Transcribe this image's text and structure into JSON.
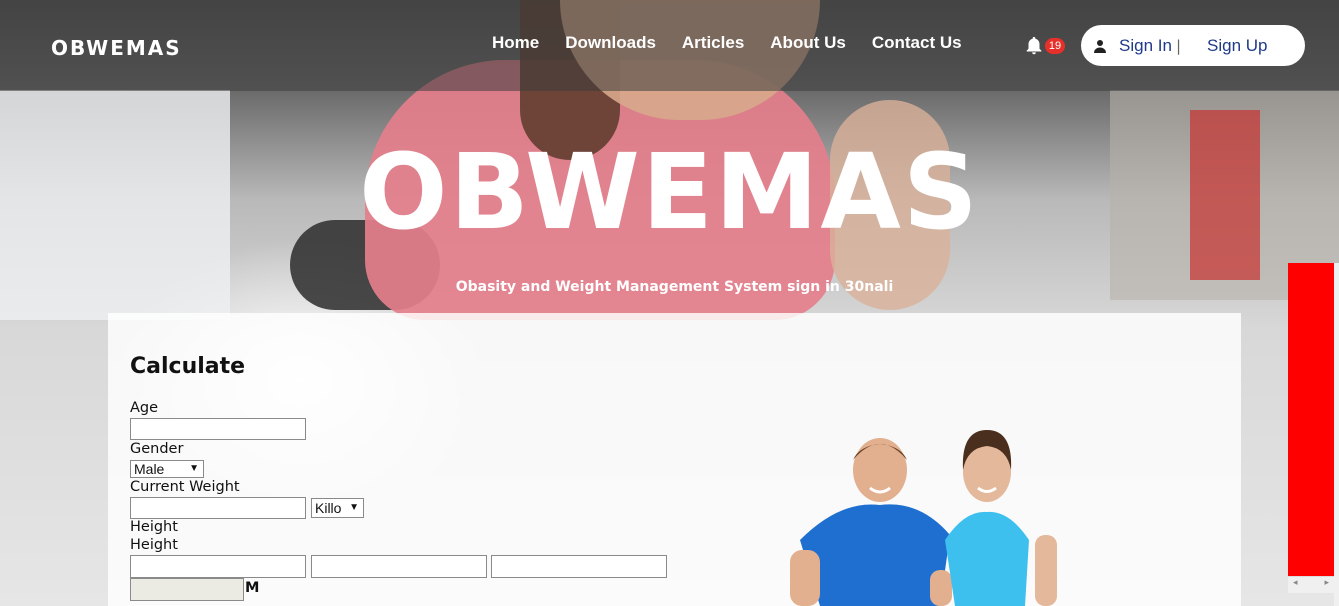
{
  "brand": "OBWEMAS",
  "nav": {
    "items": [
      "Home",
      "Downloads",
      "Articles",
      "About Us",
      "Contact Us"
    ],
    "notification_count": "19",
    "sign_in": "Sign In",
    "separator": "|",
    "sign_up": "Sign Up"
  },
  "hero": {
    "title": "OBWEMAS",
    "subtitle": "Obasity and Weight Management System sign in 30nali"
  },
  "form": {
    "title": "Calculate",
    "age_label": "Age",
    "age_value": "",
    "gender_label": "Gender",
    "gender_selected": "Male",
    "weight_label": "Current Weight",
    "weight_value": "",
    "weight_unit": "Killo",
    "height_label_1": "Height",
    "height_label_2": "Height",
    "height_values": [
      "",
      "",
      ""
    ],
    "result_value": "",
    "result_unit": "M"
  },
  "colors": {
    "accent": "#1f3a8a",
    "badge": "#e7302a",
    "widget": "#ff0000"
  }
}
